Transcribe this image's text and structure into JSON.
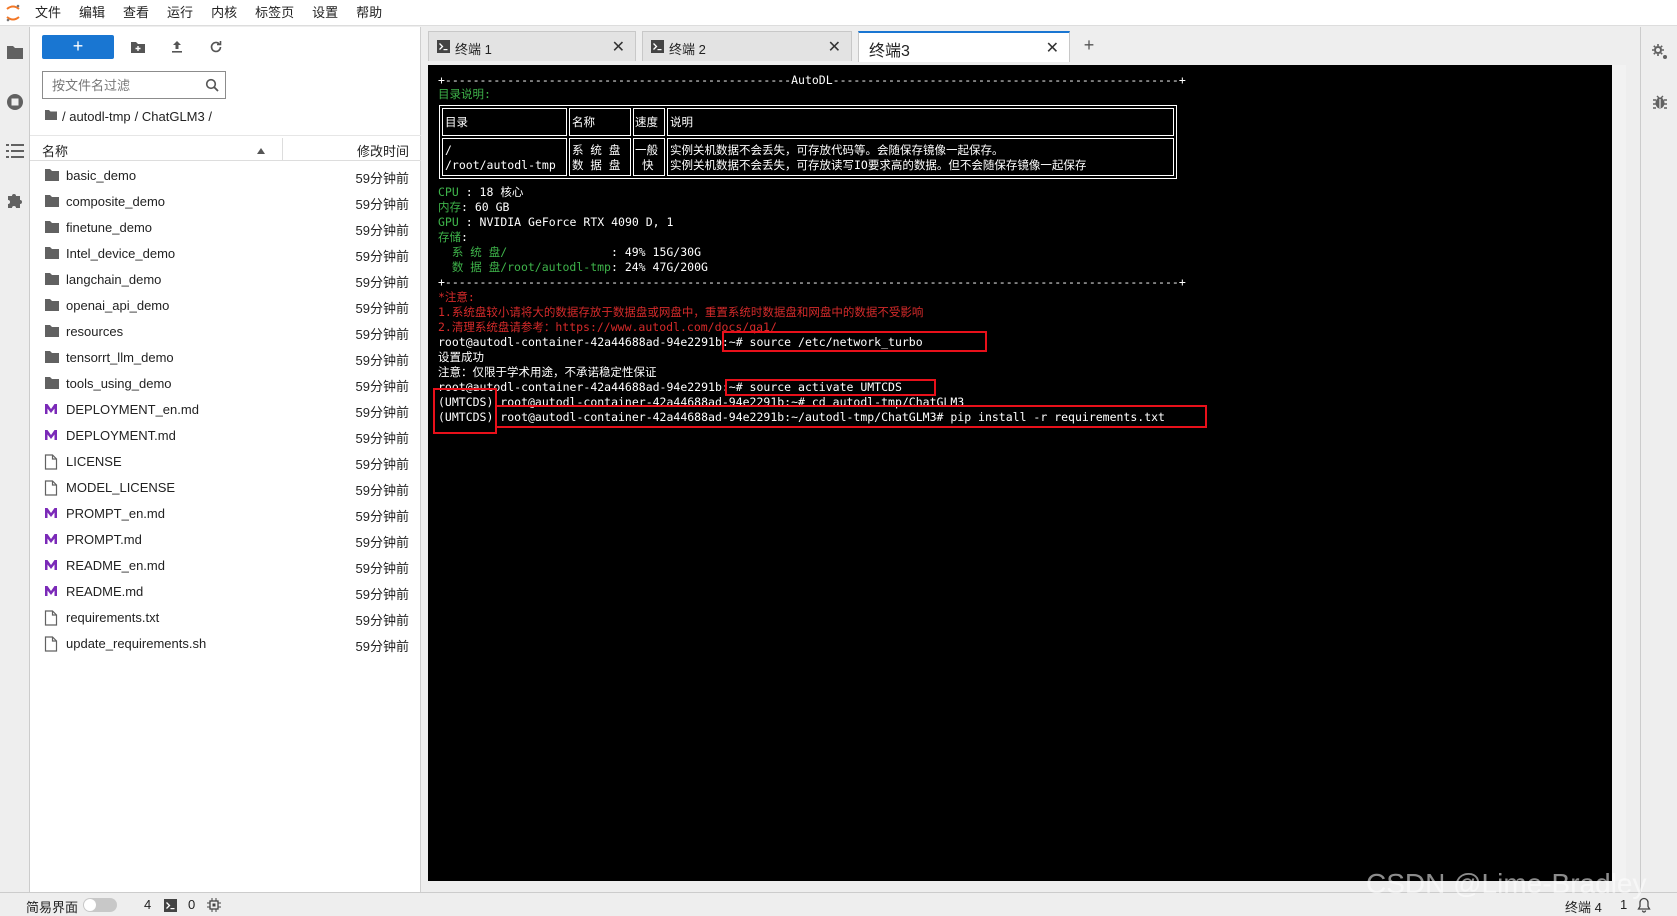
{
  "menubar": {
    "items": [
      "文件",
      "编辑",
      "查看",
      "运行",
      "内核",
      "标签页",
      "设置",
      "帮助"
    ]
  },
  "filebrowser": {
    "new_label": "+",
    "filter_placeholder": "按文件名过滤",
    "breadcrumb": [
      "/ autodl-tmp",
      "/ ChatGLM3 /"
    ],
    "col_name": "名称",
    "col_modified": "修改时间",
    "files": [
      {
        "name": "basic_demo",
        "type": "folder",
        "modified": "59分钟前"
      },
      {
        "name": "composite_demo",
        "type": "folder",
        "modified": "59分钟前"
      },
      {
        "name": "finetune_demo",
        "type": "folder",
        "modified": "59分钟前"
      },
      {
        "name": "Intel_device_demo",
        "type": "folder",
        "modified": "59分钟前"
      },
      {
        "name": "langchain_demo",
        "type": "folder",
        "modified": "59分钟前"
      },
      {
        "name": "openai_api_demo",
        "type": "folder",
        "modified": "59分钟前"
      },
      {
        "name": "resources",
        "type": "folder",
        "modified": "59分钟前"
      },
      {
        "name": "tensorrt_llm_demo",
        "type": "folder",
        "modified": "59分钟前"
      },
      {
        "name": "tools_using_demo",
        "type": "folder",
        "modified": "59分钟前"
      },
      {
        "name": "DEPLOYMENT_en.md",
        "type": "markdown",
        "modified": "59分钟前"
      },
      {
        "name": "DEPLOYMENT.md",
        "type": "markdown",
        "modified": "59分钟前"
      },
      {
        "name": "LICENSE",
        "type": "file",
        "modified": "59分钟前"
      },
      {
        "name": "MODEL_LICENSE",
        "type": "file",
        "modified": "59分钟前"
      },
      {
        "name": "PROMPT_en.md",
        "type": "markdown",
        "modified": "59分钟前"
      },
      {
        "name": "PROMPT.md",
        "type": "markdown",
        "modified": "59分钟前"
      },
      {
        "name": "README_en.md",
        "type": "markdown",
        "modified": "59分钟前"
      },
      {
        "name": "README.md",
        "type": "markdown",
        "modified": "59分钟前"
      },
      {
        "name": "requirements.txt",
        "type": "file",
        "modified": "59分钟前"
      },
      {
        "name": "update_requirements.sh",
        "type": "file",
        "modified": "59分钟前"
      }
    ]
  },
  "tabs": [
    {
      "label": "终端 1",
      "active": false
    },
    {
      "label": "终端 2",
      "active": false
    },
    {
      "label": "终端3",
      "active": true
    }
  ],
  "add_tab_label": "+",
  "terminal": {
    "border_top": "+--------------------------------------------------AutoDL--------------------------------------------------+",
    "dir_title": "目录说明:",
    "table_headers": [
      "目录",
      "名称",
      "速度",
      "说明"
    ],
    "table_row": {
      "dir_1": "/",
      "dir_2": "/root/autodl-tmp",
      "name_1": "系 统 盘",
      "name_2": "数 据 盘",
      "speed_1": "一般",
      "speed_2": "快",
      "desc_1": "实例关机数据不会丢失，可存放代码等。会随保存镜像一起保存。",
      "desc_2": "实例关机数据不会丢失，可存放读写IO要求高的数据。但不会随保存镜像一起保存"
    },
    "cpu_label": "CPU",
    "cpu_value": " : 18 核心",
    "mem_label": "内存",
    "mem_value": ": 60 GB",
    "gpu_label": "GPU",
    "gpu_value": " : NVIDIA GeForce RTX 4090 D, 1",
    "storage_label": "存储",
    "storage_colon": ":",
    "sys_disk_label": "  系 统 盘/               ",
    "sys_disk_value": ": 49% 15G/30G",
    "data_disk_label": "  数 据 盘/root/autodl-tmp",
    "data_disk_value": ": 24% 47G/200G",
    "border_bottom": "+----------------------------------------------------------------------------------------------------------+",
    "notice_title": "*注意:",
    "notice_1": "1.系统盘较小请将大的数据存放于数据盘或网盘中，重置系统时数据盘和网盘中的数据不受影响",
    "notice_2": "2.清理系统盘请参考：https://www.autodl.com/docs/qa1/",
    "cmd_1": "root@autodl-container-42a44688ad-94e2291b:~# source /etc/network_turbo",
    "out_1": "设置成功",
    "out_2": "注意：仅限于学术用途，不承诺稳定性保证",
    "cmd_2": "root@autodl-container-42a44688ad-94e2291b:~# source activate UMTCDS",
    "cmd_3": "(UMTCDS) root@autodl-container-42a44688ad-94e2291b:~# cd autodl-tmp/ChatGLM3",
    "cmd_4": "(UMTCDS) root@autodl-container-42a44688ad-94e2291b:~/autodl-tmp/ChatGLM3# pip install -r requirements.txt"
  },
  "statusbar": {
    "simple_mode": "简易界面",
    "kernels": "4",
    "terminals": "0",
    "active_tab": "终端 4",
    "notifications": "1"
  },
  "watermark": "CSDN @Lime-Bradley",
  "colors": {
    "accent": "#1976d2",
    "terminal_bg": "#000000",
    "terminal_green": "#3eb34a",
    "terminal_red": "#d42a2a",
    "highlight_box": "#e8101a",
    "markdown_icon": "#7b2ab8"
  }
}
